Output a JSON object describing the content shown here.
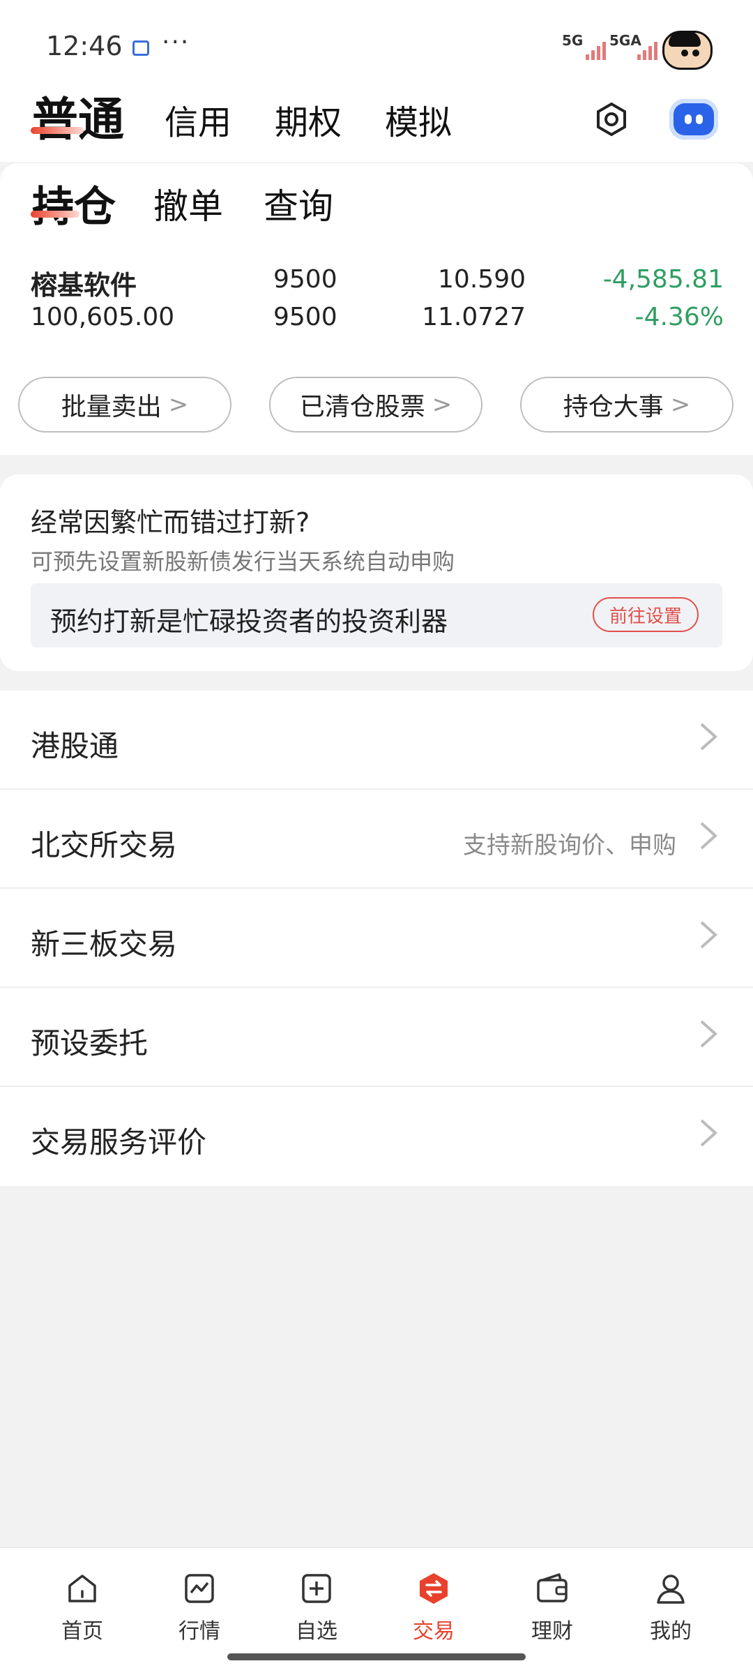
{
  "status_bar": {
    "time": "12:46",
    "more": "···",
    "network1": "5G",
    "network2": "5GA"
  },
  "account_tabs": [
    "普通",
    "信用",
    "期权",
    "模拟"
  ],
  "sub_tabs": [
    "持仓",
    "撤单",
    "查询"
  ],
  "holding": {
    "name": "榕基软件",
    "market_value": "100,605.00",
    "holding_qty": "9500",
    "available_qty": "9500",
    "current_price": "10.590",
    "cost_price": "11.0727",
    "pnl": "-4,585.81",
    "pnl_pct": "-4.36%"
  },
  "actions": [
    "批量卖出",
    "已清仓股票",
    "持仓大事"
  ],
  "ipo": {
    "title": "经常因繁忙而错过打新?",
    "subtitle": "可预先设置新股新债发行当天系统自动申购",
    "banner_text": "预约打新是忙碌投资者的投资利器",
    "button": "前往设置"
  },
  "list_items": [
    {
      "label": "港股通",
      "hint": ""
    },
    {
      "label": "北交所交易",
      "hint": "支持新股询价、申购"
    },
    {
      "label": "新三板交易",
      "hint": ""
    },
    {
      "label": "预设委托",
      "hint": ""
    },
    {
      "label": "交易服务评价",
      "hint": ""
    }
  ],
  "bottom_nav": [
    "首页",
    "行情",
    "自选",
    "交易",
    "理财",
    "我的"
  ],
  "colors": {
    "accent": "#e8422c",
    "loss": "#2f9e62"
  }
}
